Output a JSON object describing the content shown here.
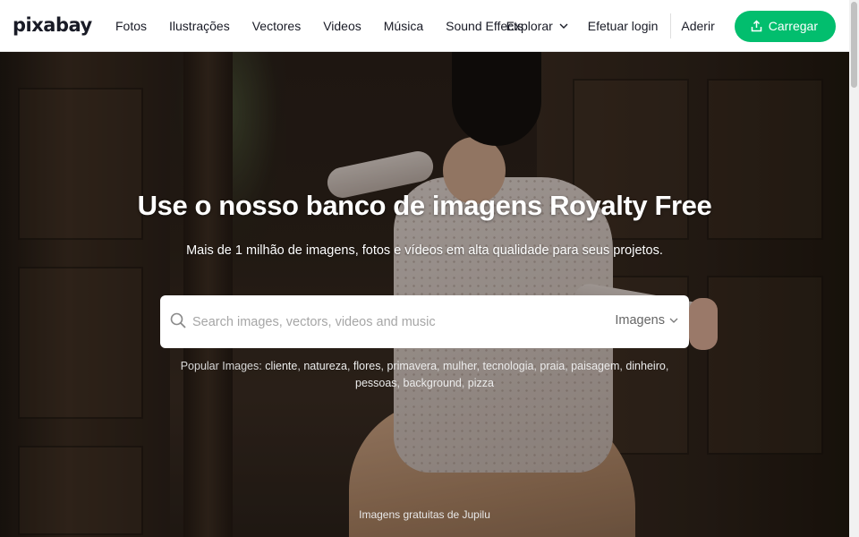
{
  "header": {
    "logo": "pixabay",
    "nav": [
      "Fotos",
      "Ilustrações",
      "Vectores",
      "Videos",
      "Música",
      "Sound Effects"
    ],
    "explore_label": "Explorar",
    "login_label": "Efetuar login",
    "join_label": "Aderir",
    "upload_label": "Carregar",
    "accent_color": "#02be6e"
  },
  "hero": {
    "title": "Use o nosso banco de imagens Royalty Free",
    "subtitle": "Mais de 1 milhão de imagens, fotos e vídeos em alta qualidade para seus projetos.",
    "search": {
      "placeholder": "Search images, vectors, videos and music",
      "value": "",
      "type_label": "Imagens"
    },
    "popular_label": "Popular Images:",
    "popular_tags": [
      "cliente",
      "natureza",
      "flores",
      "primavera",
      "mulher",
      "tecnologia",
      "praia",
      "paisagem",
      "dinheiro",
      "pessoas",
      "background",
      "pizza"
    ],
    "credit": "Imagens gratuitas de Jupilu"
  },
  "icons": {
    "search": "search-icon",
    "upload": "upload-icon",
    "chevron": "chevron-down-icon"
  }
}
